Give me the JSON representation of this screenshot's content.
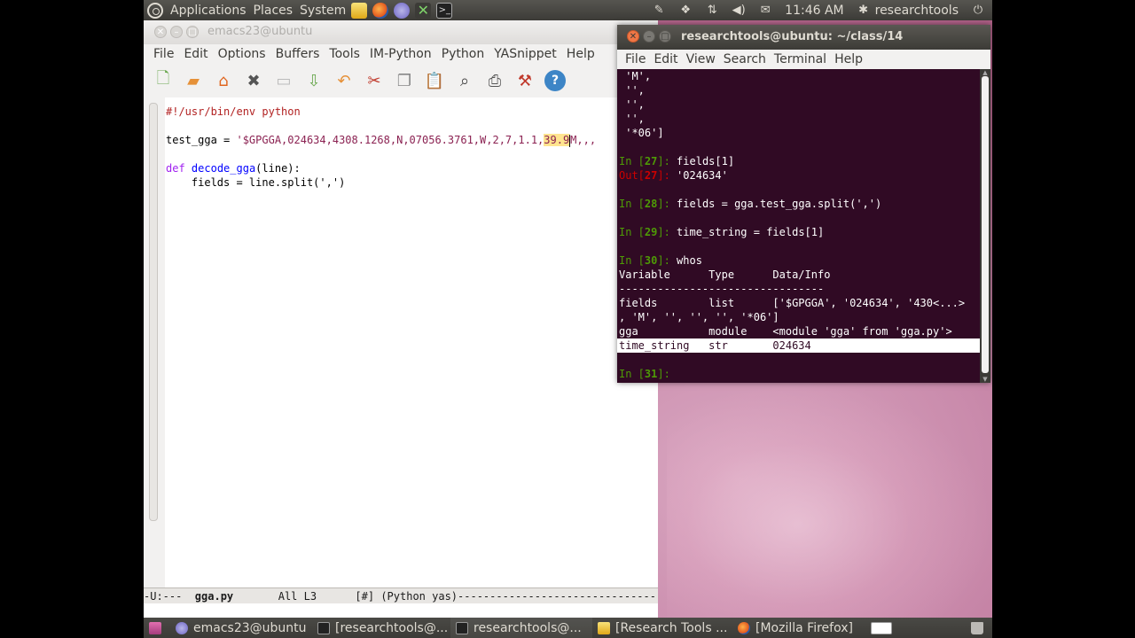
{
  "top_panel": {
    "menus": [
      "Applications",
      "Places",
      "System"
    ],
    "clock": "11:46 AM",
    "user": "researchtools"
  },
  "emacs": {
    "title": "emacs23@ubuntu",
    "menus": [
      "File",
      "Edit",
      "Options",
      "Buffers",
      "Tools",
      "IM-Python",
      "Python",
      "YASnippet",
      "Help"
    ],
    "code": {
      "shebang": "#!/usr/bin/env python",
      "var": "test_gga",
      "op": " = ",
      "str_a": "'$GPGGA,024634,4308.1268,N,07056.3761,W,2,7,1.1,",
      "str_hl": "39.9",
      "str_b": "M,,,",
      "def_kw": "def",
      "fn_name": "decode_gga",
      "def_rest": "(line):",
      "body": "    fields = line.split(',')"
    },
    "modeline": {
      "left": "-U:---  ",
      "buffer": "gga.py",
      "rest": "       All L3      [#] (Python yas)-------------------------------"
    }
  },
  "terminal": {
    "title": "researchtools@ubuntu: ~/class/14",
    "menus": [
      "File",
      "Edit",
      "View",
      "Search",
      "Terminal",
      "Help"
    ],
    "lines": [
      {
        "type": "text",
        "text": " 'M',"
      },
      {
        "type": "text",
        "text": " '',"
      },
      {
        "type": "text",
        "text": " '',"
      },
      {
        "type": "text",
        "text": " '',"
      },
      {
        "type": "text",
        "text": " '*06']"
      },
      {
        "type": "blank",
        "text": ""
      },
      {
        "type": "in",
        "prompt": "In [",
        "num": "27",
        "close": "]: ",
        "text": "fields[1]"
      },
      {
        "type": "out",
        "prompt": "Out[",
        "num": "27",
        "close": "]: ",
        "text": "'024634'"
      },
      {
        "type": "blank",
        "text": ""
      },
      {
        "type": "in",
        "prompt": "In [",
        "num": "28",
        "close": "]: ",
        "text": "fields = gga.test_gga.split(',')"
      },
      {
        "type": "blank",
        "text": ""
      },
      {
        "type": "in",
        "prompt": "In [",
        "num": "29",
        "close": "]: ",
        "text": "time_string = fields[1]"
      },
      {
        "type": "blank",
        "text": ""
      },
      {
        "type": "in",
        "prompt": "In [",
        "num": "30",
        "close": "]: ",
        "text": "whos"
      },
      {
        "type": "text",
        "text": "Variable      Type      Data/Info"
      },
      {
        "type": "text",
        "text": "--------------------------------"
      },
      {
        "type": "text",
        "text": "fields        list      ['$GPGGA', '024634', '430<...>"
      },
      {
        "type": "text",
        "text": ", 'M', '', '', '', '*06']"
      },
      {
        "type": "text",
        "text": "gga           module    <module 'gga' from 'gga.py'>"
      },
      {
        "type": "sel",
        "text": "time_string   str       024634"
      },
      {
        "type": "blank",
        "text": ""
      },
      {
        "type": "in",
        "prompt": "In [",
        "num": "31",
        "close": "]: ",
        "text": ""
      }
    ]
  },
  "taskbar": {
    "items": [
      "emacs23@ubuntu",
      "[researchtools@...",
      "researchtools@...",
      "[Research Tools ...",
      "[Mozilla Firefox]"
    ]
  },
  "colors": {
    "terminal_bg": "#300a24",
    "prompt_in": "#4e9a06",
    "prompt_out": "#cc0000",
    "close_button": "#f07746"
  }
}
